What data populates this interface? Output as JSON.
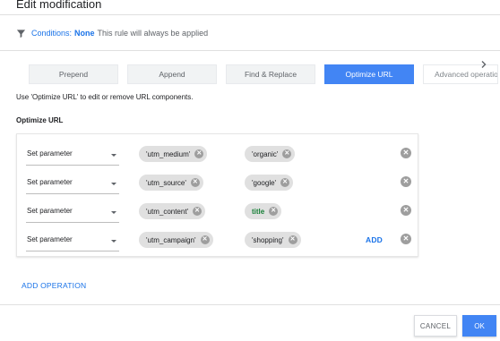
{
  "header": {
    "title": "Edit modification"
  },
  "conditions": {
    "icon": "filter-icon",
    "label": "Conditions:",
    "value": "None",
    "description": "This rule will always be applied"
  },
  "tabs": [
    {
      "label": "Prepend",
      "active": false
    },
    {
      "label": "Append",
      "active": false
    },
    {
      "label": "Find & Replace",
      "active": false
    },
    {
      "label": "Optimize URL",
      "active": true
    },
    {
      "label": "Advanced operations",
      "active": false
    }
  ],
  "tabs_scroll_icon": "chevron-right-icon",
  "hint": "Use 'Optimize URL' to edit or remove URL components.",
  "section_title": "Optimize URL",
  "operations": [
    {
      "action": "Set parameter",
      "key": "'utm_medium'",
      "value": "'organic'",
      "value_is_macro": false,
      "show_add": false
    },
    {
      "action": "Set parameter",
      "key": "'utm_source'",
      "value": "'google'",
      "value_is_macro": false,
      "show_add": false
    },
    {
      "action": "Set parameter",
      "key": "'utm_content'",
      "value": "title",
      "value_is_macro": true,
      "show_add": false
    },
    {
      "action": "Set parameter",
      "key": "'utm_campaign'",
      "value": "'shopping'",
      "value_is_macro": false,
      "show_add": true
    }
  ],
  "add_label": "ADD",
  "add_operation_label": "ADD OPERATION",
  "footer": {
    "cancel_label": "CANCEL",
    "ok_label": "OK"
  },
  "colors": {
    "accent": "#1a73e8",
    "primary_button": "#4285f4",
    "macro_text": "#188038",
    "chip_bg": "#e0e0e0"
  }
}
